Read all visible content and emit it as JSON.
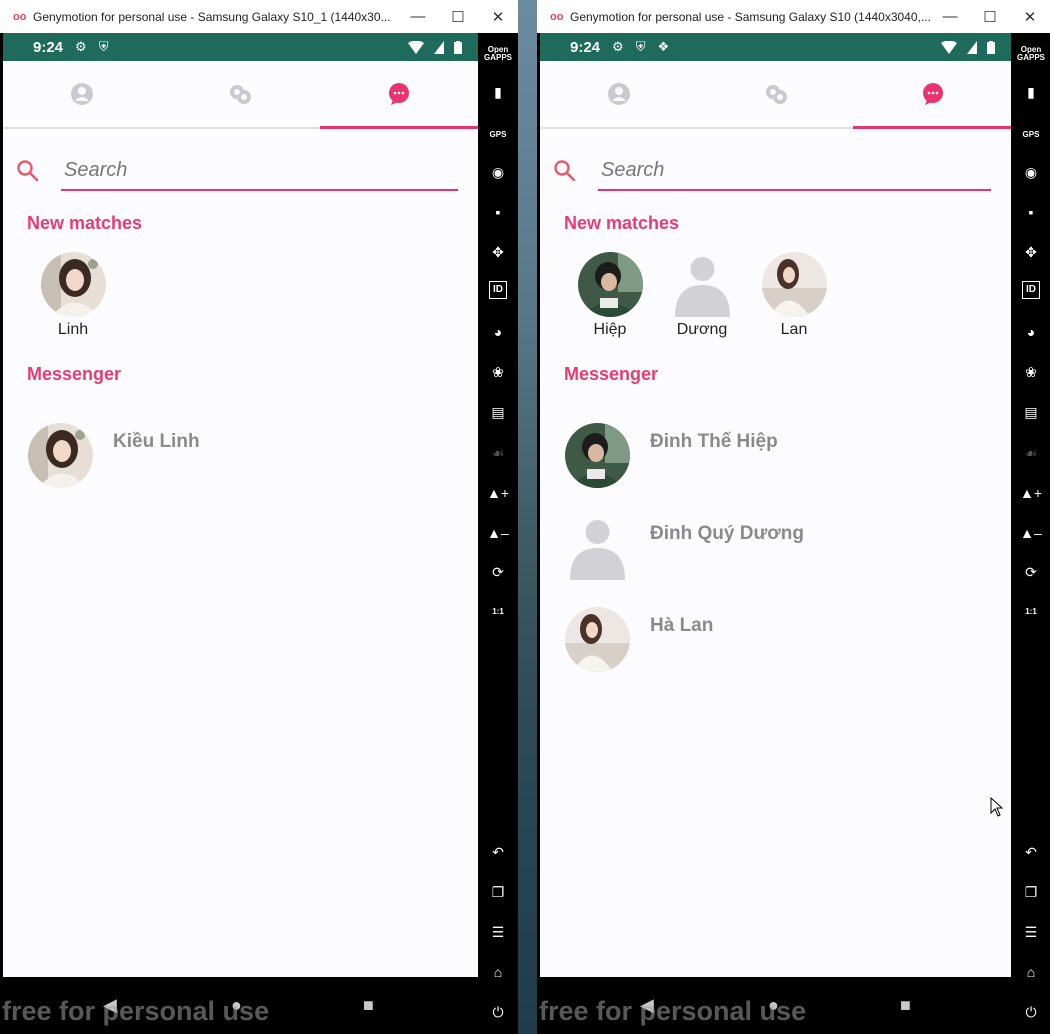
{
  "windows": [
    {
      "title": "Genymotion for personal use - Samsung Galaxy S10_1 (1440x30...",
      "statusbar": {
        "time": "9:24"
      },
      "search_placeholder": "Search",
      "sections": {
        "new_matches": "New matches",
        "messenger": "Messenger"
      },
      "matches": [
        {
          "name": "Linh",
          "avatar": "photo-woman"
        }
      ],
      "conversations": [
        {
          "name": "Kiều Linh",
          "avatar": "photo-woman"
        }
      ]
    },
    {
      "title": "Genymotion for personal use - Samsung Galaxy S10 (1440x3040,...",
      "statusbar": {
        "time": "9:24"
      },
      "search_placeholder": "Search",
      "sections": {
        "new_matches": "New matches",
        "messenger": "Messenger"
      },
      "matches": [
        {
          "name": "Hiệp",
          "avatar": "photo-man"
        },
        {
          "name": "Dương",
          "avatar": "default-person"
        },
        {
          "name": "Lan",
          "avatar": "photo-woman-light"
        }
      ],
      "conversations": [
        {
          "name": "Đinh Thế Hiệp",
          "avatar": "photo-man"
        },
        {
          "name": "Đinh Quý Dương",
          "avatar": "default-person"
        },
        {
          "name": "Hà Lan",
          "avatar": "photo-woman-light"
        }
      ]
    }
  ],
  "toolbar": {
    "open_gapps_label": "Open GAPPS",
    "gps_label": "GPS",
    "id_label": "ID",
    "one_to_one_label": "1:1"
  },
  "watermark": "free for personal use",
  "colors": {
    "accent": "#e8336e",
    "statusbar": "#1e6b5c",
    "titlebar_bg": "#ffffff",
    "inactive_tab": "#c9c9cf"
  },
  "icons": {
    "tabs": [
      "profile-icon",
      "matches-icon",
      "chat-icon"
    ],
    "nav": [
      "back-icon",
      "home-icon",
      "recents-icon"
    ]
  }
}
